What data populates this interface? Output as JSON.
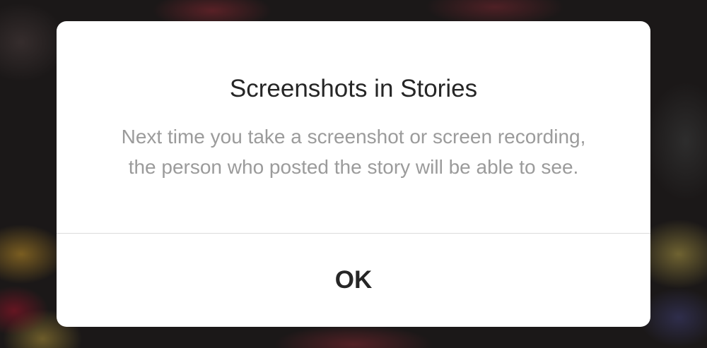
{
  "dialog": {
    "title": "Screenshots in Stories",
    "message": "Next time you take a screenshot or screen recording, the person who posted the story will be able to see.",
    "ok_label": "OK"
  },
  "colors": {
    "title_text": "#262626",
    "message_text": "#9b9b9b",
    "divider": "#dbdbdb",
    "dialog_background": "#ffffff"
  }
}
